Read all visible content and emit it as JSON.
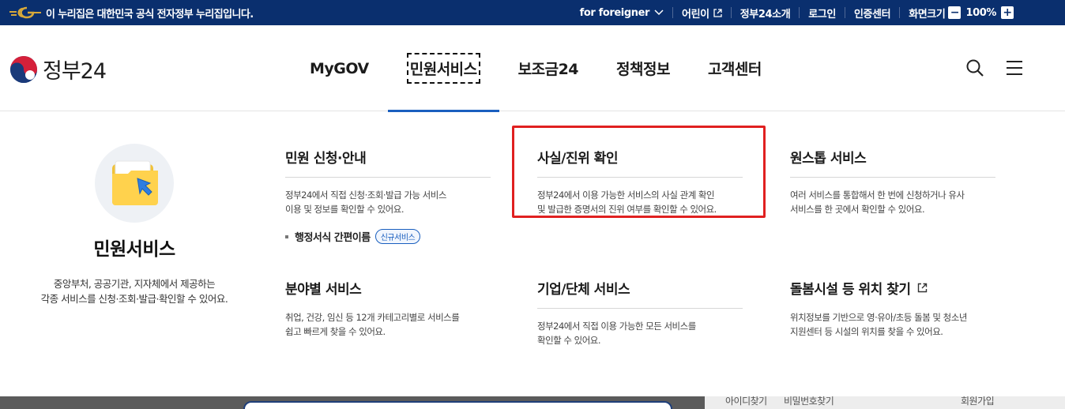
{
  "topbar": {
    "notice": "이 누리집은 대한민국 공식 전자정부 누리집입니다.",
    "links": [
      {
        "label": "for foreigner"
      },
      {
        "label": "어린이"
      },
      {
        "label": "정부24소개"
      },
      {
        "label": "로그인"
      },
      {
        "label": "인증센터"
      },
      {
        "label": "화면크기"
      }
    ],
    "zoom": "100%",
    "colors": {
      "bg": "#0a2f6e"
    }
  },
  "header": {
    "logo_text": "정부24",
    "menus": [
      {
        "label": "MyGOV"
      },
      {
        "label": "민원서비스"
      },
      {
        "label": "보조금24"
      },
      {
        "label": "정책정보"
      },
      {
        "label": "고객센터"
      }
    ],
    "active_menu": "민원서비스",
    "icons": [
      "search-icon",
      "menu-icon"
    ]
  },
  "mega": {
    "intro": {
      "title": "민원서비스",
      "desc_line1": "중앙부처, 공공기관, 지자체에서 제공하는",
      "desc_line2": "각종 서비스를 신청·조회·발급·확인할 수 있어요."
    },
    "cards": [
      {
        "title": "민원 신청·안내",
        "desc_line1": "정부24에서 직접 신청·조회·발급 가능 서비스",
        "desc_line2": "이용 및 정보를 확인할 수 있어요.",
        "sublink": "행정서식 간편이름",
        "badge": "신규서비스"
      },
      {
        "title": "사실/진위 확인",
        "desc_line1": "정부24에서 이용 가능한 서비스의 사실 관계 확인",
        "desc_line2": "및 발급한 증명서의 진위 여부를 확인할 수 있어요."
      },
      {
        "title": "원스톱 서비스",
        "desc_line1": "여러 서비스를 통합해서 한 번에 신청하거나 유사",
        "desc_line2": "서비스를 한 곳에서 확인할 수 있어요."
      },
      {
        "title": "분야별 서비스",
        "desc_line1": "취업, 건강, 임신 등 12개 카테고리별로 서비스를",
        "desc_line2": "쉽고 빠르게 찾을 수 있어요."
      },
      {
        "title": "기업/단체 서비스",
        "desc_line1": "정부24에서 직접 이용 가능한 모든 서비스를",
        "desc_line2": "확인할 수 있어요."
      },
      {
        "title": "돌봄시설 등 위치 찾기",
        "desc_line1": "위치정보를 기반으로 영·유아/초등 돌봄 및 청소년",
        "desc_line2": "지원센터 등 시설의 위치를 찾을 수 있어요."
      }
    ]
  },
  "underlay": {
    "links": [
      "아이디찾기",
      "비밀번호찾기",
      "회원가입"
    ]
  }
}
